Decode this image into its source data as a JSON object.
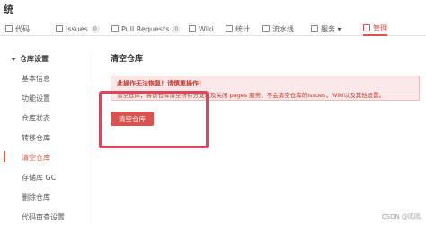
{
  "page_title": "统",
  "tabs": [
    {
      "label": "代码",
      "icon": "code-icon"
    },
    {
      "label": "Issues",
      "badge": "0",
      "icon": "issues-icon"
    },
    {
      "label": "Pull Requests",
      "badge": "0",
      "icon": "pull-request-icon"
    },
    {
      "label": "Wiki",
      "icon": "wiki-icon"
    },
    {
      "label": "统计",
      "icon": "stats-icon"
    },
    {
      "label": "流水线",
      "icon": "pipeline-icon"
    },
    {
      "label": "服务 ▾",
      "icon": "services-icon"
    },
    {
      "label": "管理",
      "icon": "settings-icon",
      "active": true
    }
  ],
  "sidebar": {
    "header": "仓库设置",
    "items": [
      {
        "label": "基本信息"
      },
      {
        "label": "功能设置"
      },
      {
        "label": "仓库状态"
      },
      {
        "label": "转移仓库"
      },
      {
        "label": "清空仓库",
        "active": true
      },
      {
        "label": "存储库 GC"
      },
      {
        "label": "删除仓库"
      },
      {
        "label": "代码审查设置"
      }
    ]
  },
  "main": {
    "title": "清空仓库",
    "alert_title": "此操作无法恢复！请慎重操作！",
    "alert_body": "清空仓库，将该仓库清空所有分支以及关闭 pages 服务，不会清空仓库的Issues，Wiki以及其他设置。",
    "button_label": "清空仓库"
  },
  "watermark": "CSDN @鸣鸣",
  "colors": {
    "accent": "#d9534f",
    "alert_bg": "#fbe9e9",
    "highlight": "#e0455c"
  }
}
